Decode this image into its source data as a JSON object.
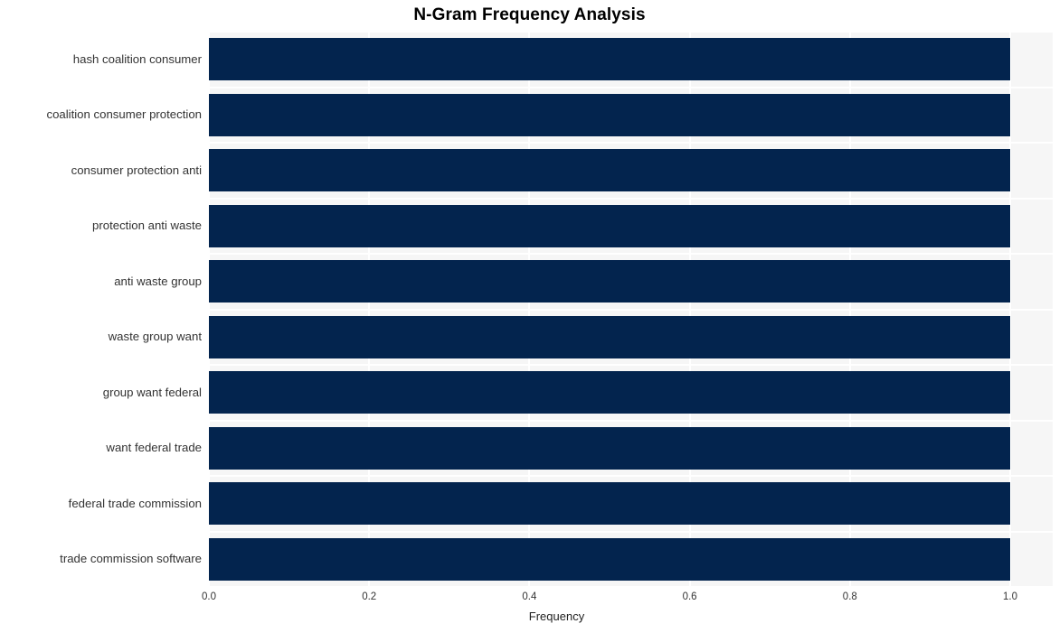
{
  "chart_data": {
    "type": "bar",
    "orientation": "horizontal",
    "title": "N-Gram Frequency Analysis",
    "xlabel": "Frequency",
    "ylabel": "",
    "categories": [
      "hash coalition consumer",
      "coalition consumer protection",
      "consumer protection anti",
      "protection anti waste",
      "anti waste group",
      "waste group want",
      "group want federal",
      "want federal trade",
      "federal trade commission",
      "trade commission software"
    ],
    "values": [
      1.0,
      1.0,
      1.0,
      1.0,
      1.0,
      1.0,
      1.0,
      1.0,
      1.0,
      1.0
    ],
    "xlim": [
      0.0,
      1.0
    ],
    "xticks": [
      "0.0",
      "0.2",
      "0.4",
      "0.6",
      "0.8",
      "1.0"
    ],
    "xtick_values": [
      0.0,
      0.2,
      0.4,
      0.6,
      0.8,
      1.0
    ],
    "grid": true,
    "legend": null,
    "bar_color": "#03244e",
    "plot_background": "#f6f6f6",
    "gridline_color": "#ffffff",
    "figure_background": "#ffffff"
  }
}
